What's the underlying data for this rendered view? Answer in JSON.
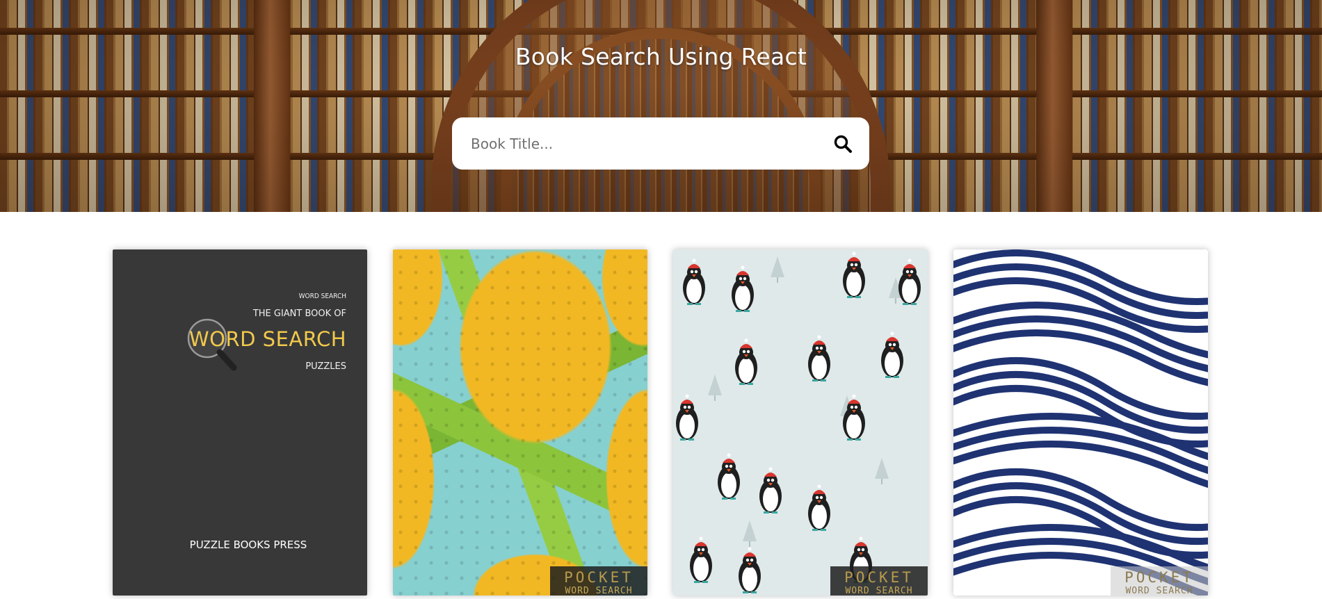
{
  "header": {
    "title": "Book Search Using React",
    "search_placeholder": "Book Title...",
    "search_icon": "search-icon"
  },
  "books": [
    {
      "cover_style": "dark-typography",
      "series_label": "WORD SEARCH",
      "subtitle": "THE GIANT BOOK OF",
      "title": "WORD SEARCH",
      "tagline": "PUZZLES",
      "publisher": "PUZZLE BOOKS PRESS"
    },
    {
      "cover_style": "pineapple-pattern",
      "badge_line1": "POCKET",
      "badge_line2": "WORD SEARCH"
    },
    {
      "cover_style": "penguin-pattern",
      "badge_line1": "POCKET",
      "badge_line2": "WORD SEARCH"
    },
    {
      "cover_style": "blue-wave-pattern",
      "badge_line1": "POCKET",
      "badge_line2": "WORD SEARCH"
    }
  ],
  "colors": {
    "title_text": "#ffffff",
    "search_box": "#ffffff",
    "page_background": "#ffffff",
    "accent_gold": "#f2c94c"
  }
}
